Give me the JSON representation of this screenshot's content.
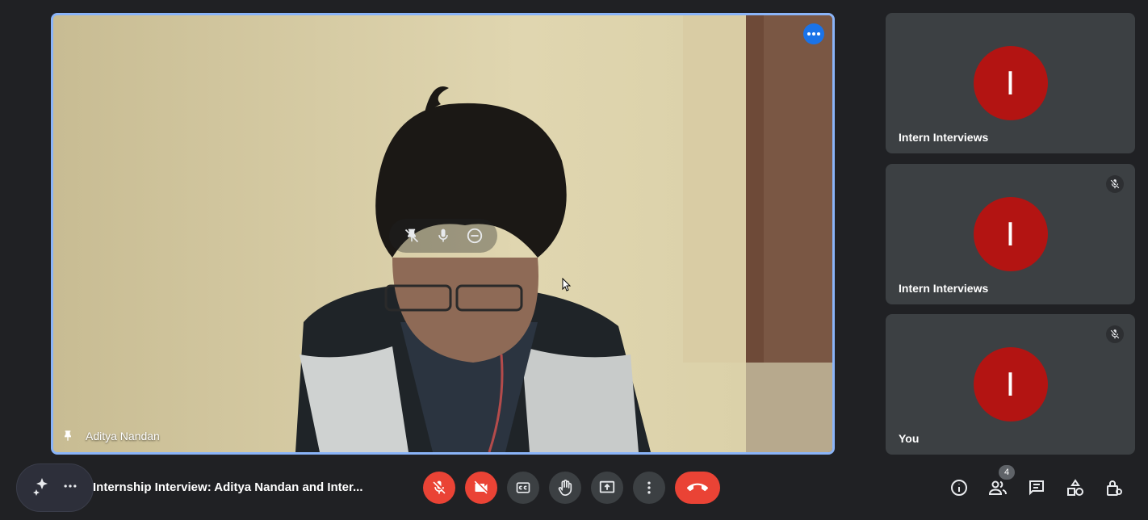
{
  "main_video": {
    "participant_name": "Aditya Nandan",
    "more_options_icon": "more-horiz-icon",
    "hover_controls": [
      "pin-off-icon",
      "mic-icon",
      "remove-icon"
    ]
  },
  "side_tiles": [
    {
      "name": "Intern Interviews",
      "avatar_letter": "I",
      "muted": false
    },
    {
      "name": "Intern Interviews",
      "avatar_letter": "I",
      "muted": true
    },
    {
      "name": "You",
      "avatar_letter": "I",
      "muted": true
    }
  ],
  "bottom_bar": {
    "meeting_title": "Internship Interview: Aditya Nandan and Inter...",
    "controls": [
      "mic-off-icon",
      "camera-off-icon",
      "captions-icon",
      "raise-hand-icon",
      "present-icon",
      "more-vert-icon",
      "hang-up-icon"
    ],
    "right_controls": [
      "info-icon",
      "people-icon",
      "chat-icon",
      "activities-icon",
      "host-controls-icon"
    ],
    "participant_count": "4"
  },
  "colors": {
    "background": "#202124",
    "tile": "#3c4043",
    "active_border": "#8ab4f8",
    "danger": "#ea4335",
    "avatar": "#b31412"
  }
}
